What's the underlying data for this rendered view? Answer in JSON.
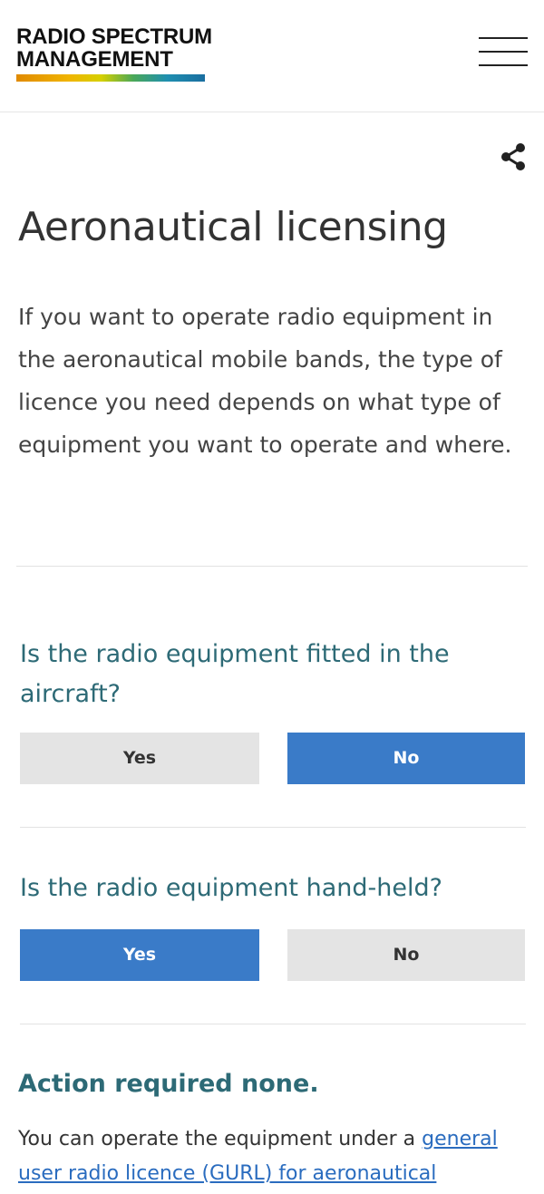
{
  "header": {
    "logo_line1": "RADIO SPECTRUM",
    "logo_line2": "MANAGEMENT",
    "menu_icon": "hamburger-menu-icon"
  },
  "share_icon": "share-icon",
  "page": {
    "title": "Aeronautical licensing",
    "intro": "If you want to operate radio equipment in the aeronautical mobile bands, the type of licence you need depends on what type of equipment you want to operate and where."
  },
  "questions": [
    {
      "text": "Is the radio equipment fitted in the aircraft?",
      "options": [
        "Yes",
        "No"
      ],
      "selected": "No"
    },
    {
      "text": "Is the radio equipment hand-held?",
      "options": [
        "Yes",
        "No"
      ],
      "selected": "Yes"
    }
  ],
  "action": {
    "title": "Action required none.",
    "text_prefix": "You can operate the equipment under a ",
    "link_text": "general user radio licence (GURL) for aeronautical"
  },
  "colors": {
    "accent_blue": "#3a7bc8",
    "heading_teal": "#2d6a76",
    "link": "#2a6cbf"
  }
}
